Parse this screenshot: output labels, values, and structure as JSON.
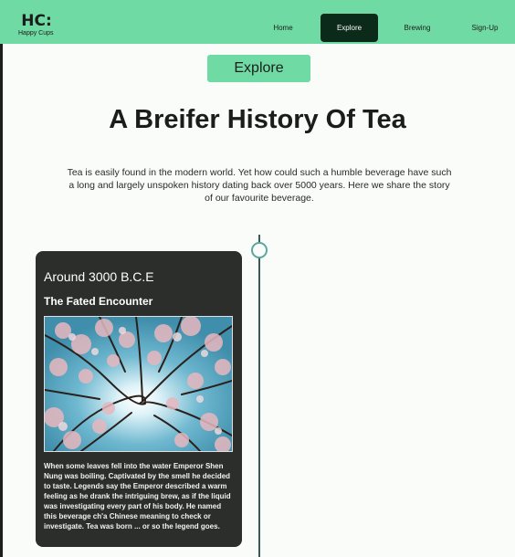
{
  "logo": {
    "mark": "HC:",
    "tagline": "Happy Cups"
  },
  "nav": {
    "items": [
      {
        "label": "Home"
      },
      {
        "label": "Explore"
      },
      {
        "label": "Brewing"
      },
      {
        "label": "Sign-Up"
      }
    ],
    "active": "Explore"
  },
  "hero": {
    "badge": "Explore",
    "title": "A Breifer History Of Tea",
    "intro": "Tea is easily found in the modern world. Yet how could such a humble beverage have such a long and largely unspoken history dating back over 5000 years. Here we share the story of our favourite beverage."
  },
  "timeline": {
    "entries": [
      {
        "date": "Around 3000 B.C.E",
        "heading": "The Fated Encounter",
        "body": "When some leaves fell into the water Emperor Shen Nung was boiling. Captivated by the smell he decided to taste. Legends say the Emperor described a warm feeling as he drank the intriguing brew, as if the liquid was investigating every part of his body. He named this beverage ch'a Chinese meaning to check or investigate. Tea was born ... or so the legend goes."
      }
    ]
  },
  "colors": {
    "accent": "#6fdaa3",
    "nav_active": "#0b2a19",
    "card_bg": "#2c2e2b",
    "page_bg": "#fafcf9"
  }
}
